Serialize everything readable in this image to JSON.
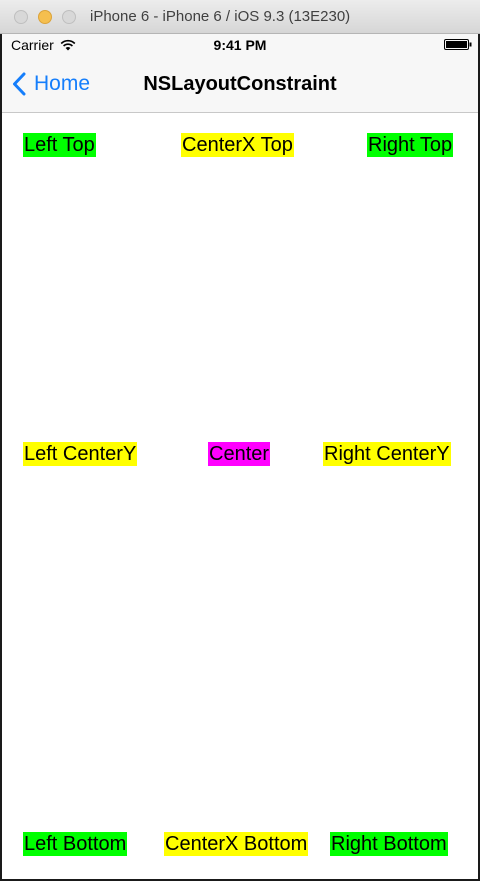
{
  "window": {
    "title": "iPhone 6 - iPhone 6 / iOS 9.3 (13E230)"
  },
  "status_bar": {
    "carrier": "Carrier",
    "time": "9:41 PM"
  },
  "nav": {
    "back_label": "Home",
    "title": "NSLayoutConstraint"
  },
  "labels": {
    "left_top": "Left Top",
    "centerx_top": "CenterX Top",
    "right_top": "Right Top",
    "left_centery": "Left CenterY",
    "center": "Center",
    "right_centery": "Right CenterY",
    "left_bottom": "Left Bottom",
    "centerx_bottom": "CenterX Bottom",
    "right_bottom": "Right Bottom"
  },
  "colors": {
    "green": "#00ff00",
    "yellow": "#ffff00",
    "magenta": "#ff00ff",
    "ios_blue": "#157efb"
  },
  "icons": {
    "back": "chevron-left-icon",
    "wifi": "wifi-icon",
    "battery": "battery-icon"
  }
}
